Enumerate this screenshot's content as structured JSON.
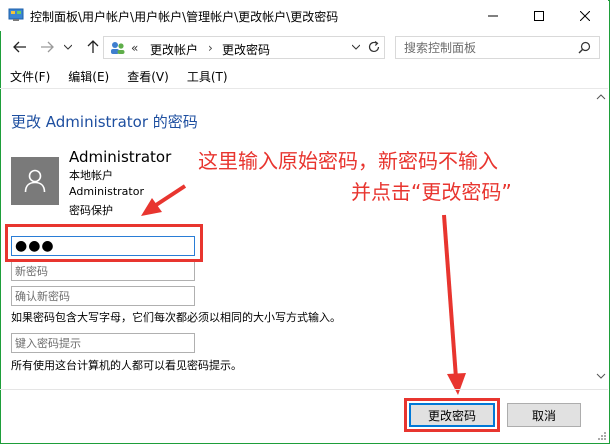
{
  "window": {
    "title": "控制面板\\用户帐户\\用户帐户\\管理帐户\\更改帐户\\更改密码"
  },
  "nav": {
    "breadcrumb_overflow": "«",
    "crumbs": [
      "更改帐户",
      "更改密码"
    ],
    "search_placeholder": "搜索控制面板"
  },
  "menu": {
    "items": [
      "文件(F)",
      "编辑(E)",
      "查看(V)",
      "工具(T)"
    ]
  },
  "page": {
    "title": "更改 Administrator 的密码"
  },
  "account": {
    "name": "Administrator",
    "type": "本地帐户",
    "group": "Administrator",
    "protection": "密码保护"
  },
  "form": {
    "current_password_value": "●●●",
    "new_password_placeholder": "新密码",
    "confirm_password_placeholder": "确认新密码",
    "case_note": "如果密码包含大写字母，它们每次都必须以相同的大小写方式输入。",
    "hint_placeholder": "键入密码提示",
    "hint_note": "所有使用这台计算机的人都可以看见密码提示。"
  },
  "annotation": {
    "line1": "这里输入原始密码，新密码不输入",
    "line2": "并点击“更改密码”",
    "color": "#e8352f"
  },
  "buttons": {
    "change_password": "更改密码",
    "cancel": "取消"
  },
  "colors": {
    "title_blue": "#1e4fa0",
    "window_border": "#1e9e3a",
    "focus_blue": "#0078d7"
  }
}
